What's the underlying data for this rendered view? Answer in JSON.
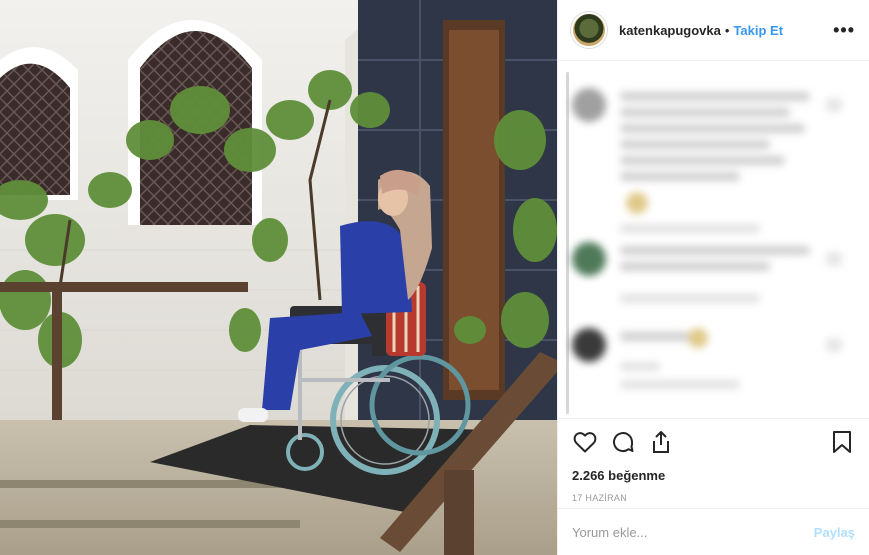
{
  "post": {
    "photo_icon": "photo-of-woman-in-wheelchair-by-church-door"
  },
  "header": {
    "username": "katenkapugovka",
    "separator": "•",
    "follow_label": "Takip Et",
    "more_icon": "more-horizontal-icon",
    "more_label": "•••"
  },
  "actions": {
    "like_icon": "heart-icon",
    "comment_icon": "comment-bubble-icon",
    "share_icon": "share-icon",
    "save_icon": "bookmark-icon",
    "likes_text": "2.266 beğenme",
    "date_text": "17 HAZİRAN"
  },
  "add_comment": {
    "placeholder": "Yorum ekle...",
    "post_label": "Paylaş"
  },
  "colors": {
    "accent": "#3897f0",
    "post_disabled": "#b2dffc",
    "text": "#262626",
    "muted": "#999999"
  }
}
